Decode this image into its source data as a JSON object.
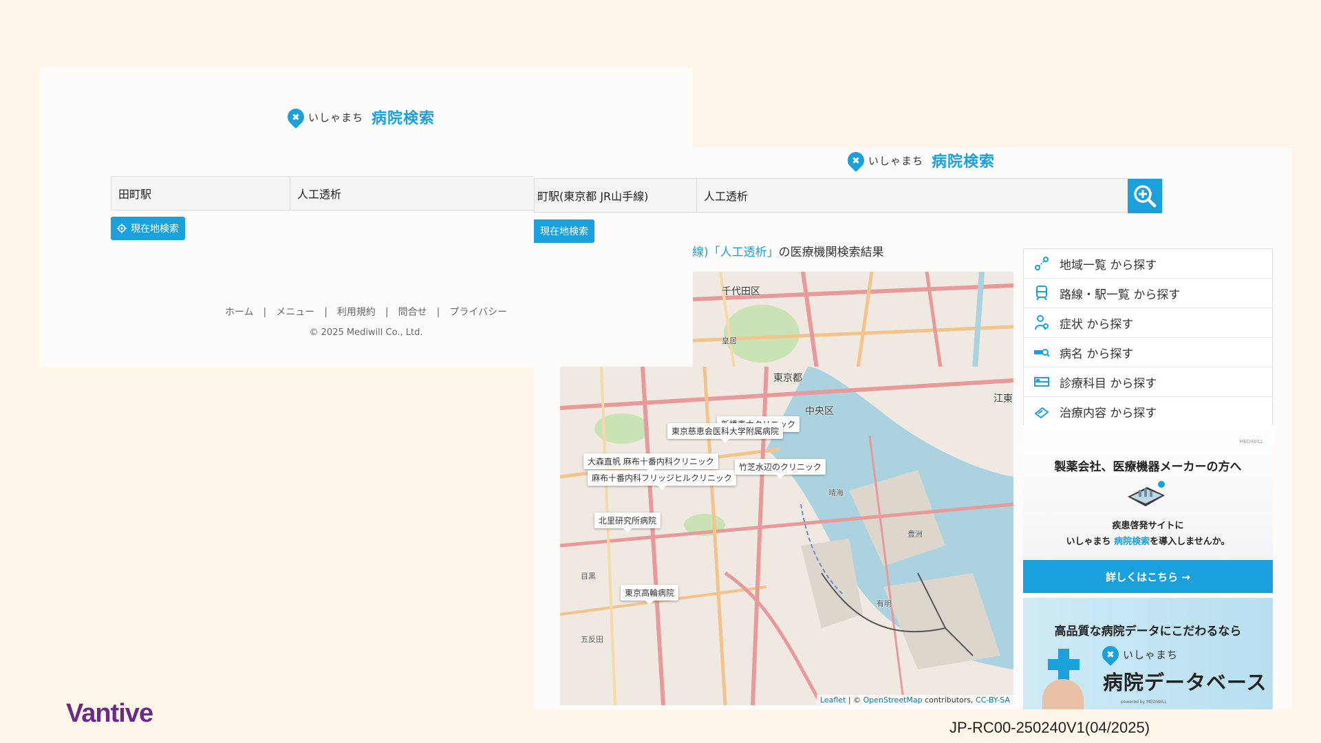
{
  "brand": {
    "small": "いしゃまち",
    "big": "病院検索"
  },
  "screen1": {
    "station_value": "田町駅",
    "keyword_value": "人工透析",
    "location_button": "現在地検索",
    "footer_links": [
      "ホーム",
      "メニュー",
      "利用規約",
      "問合せ",
      "プライバシー"
    ],
    "footer_sep": "|",
    "copyright": "© 2025 Mediwill Co., Ltd."
  },
  "screen2": {
    "station_value": "町駅(東京都 JR山手線)",
    "keyword_value": "人工透析",
    "location_button": "現在地検索",
    "result_prefix": "線)「",
    "result_query": "人工透析」",
    "result_suffix": "の医療機関検索結果",
    "menu": [
      {
        "label": "地域一覧 から探す",
        "icon": "map-route-icon"
      },
      {
        "label": "路線・駅一覧 から探す",
        "icon": "train-icon"
      },
      {
        "label": "症状 から探す",
        "icon": "person-icon"
      },
      {
        "label": "病名 から探す",
        "icon": "disease-search-icon"
      },
      {
        "label": "診療科目 から探す",
        "icon": "hospital-bed-icon"
      },
      {
        "label": "治療内容 から探す",
        "icon": "treatment-icon"
      }
    ],
    "ad1": {
      "title": "製薬会社、医療機器メーカーの方へ",
      "text1": "疾患啓発サイトに",
      "text2_brand_small": "いしゃまち",
      "text2_brand_big": "病院検索",
      "text2_suffix": "を導入しませんか。",
      "mini_logo": "MEDIWILL",
      "button": "詳しくはこちら →"
    },
    "ad2": {
      "title": "高品質な病院データにこだわるなら",
      "brand_small": "いしゃまち",
      "big": "病院データベース",
      "powered": "powered by MEDIWILL"
    }
  },
  "map": {
    "pins": [
      "新橋素木クリニック",
      "東京慈恵会医科大学附属病院",
      "大森直帆 麻布十番内科クリニック",
      "麻布十番内科フリッジヒルクリニック",
      "竹芝水辺のクリニック",
      "北里研究所病院",
      "東京高輪病院"
    ],
    "labels": [
      "千代田区",
      "東京都",
      "中央区",
      "江東",
      "皇居",
      "晴海",
      "有明",
      "目黒",
      "五反田",
      "豊洲"
    ],
    "attribution_leaflet": "Leaflet",
    "attribution_mid": " | © ",
    "attribution_osm": "OpenStreetMap",
    "attribution_contrib": " contributors, ",
    "attribution_license": "CC-BY-SA"
  },
  "logo_text": "Vantive",
  "doc_id": "JP-RC00-250240V1(04/2025)",
  "colors": {
    "accent": "#1aa0db",
    "vantive": "#6b2a8a",
    "background": "#fdf6e9"
  }
}
